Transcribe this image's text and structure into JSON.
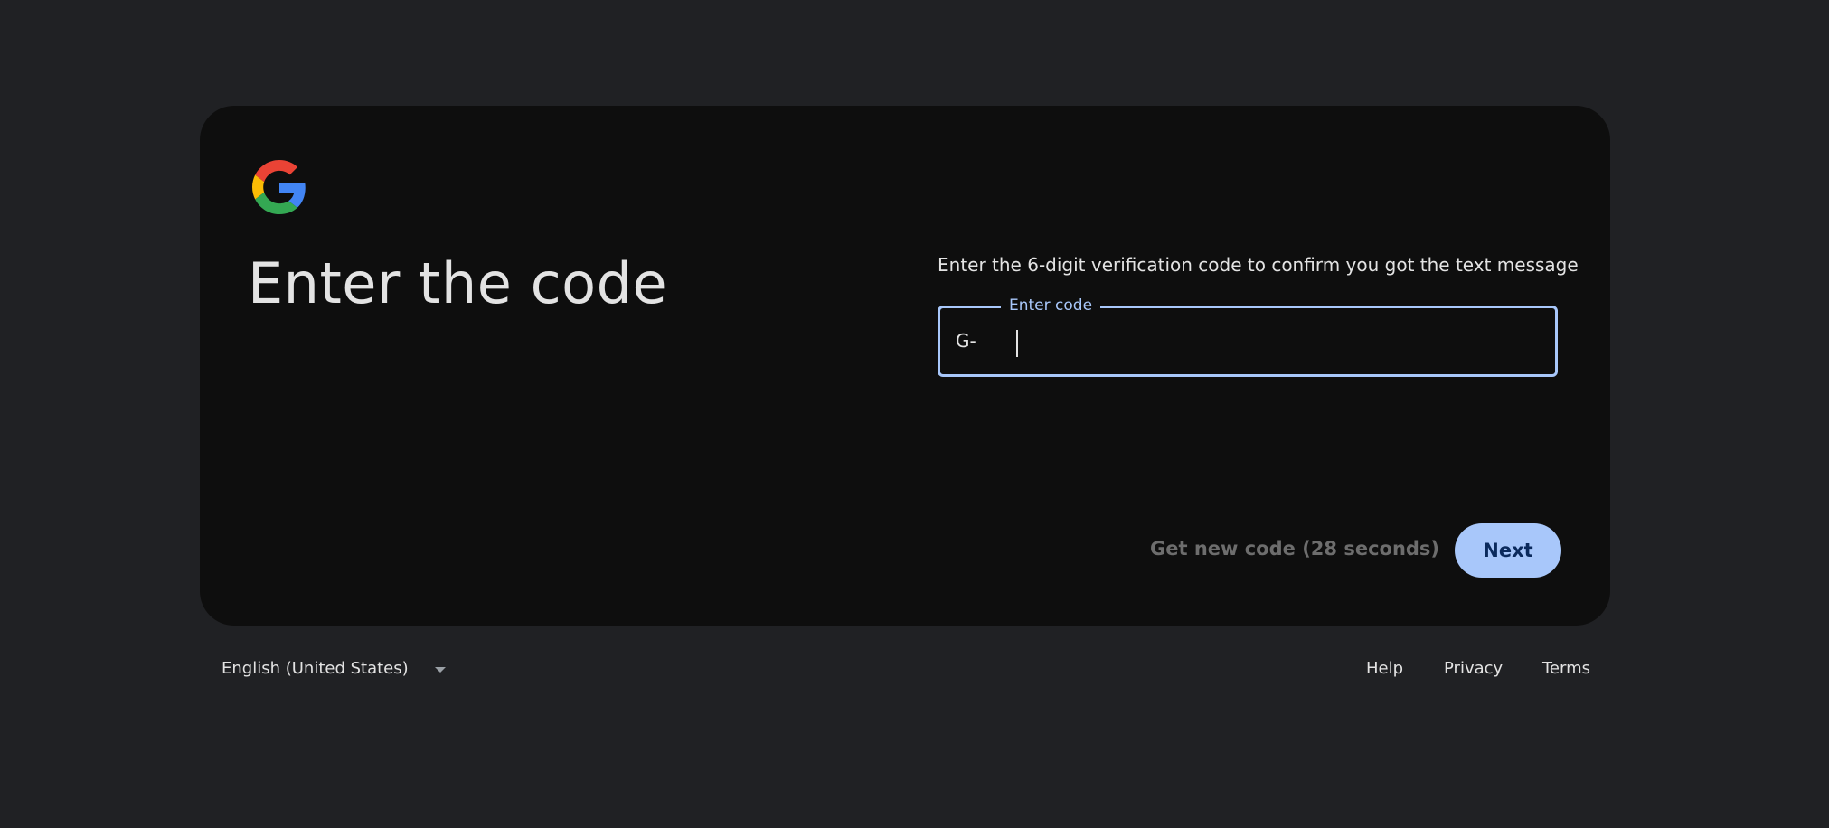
{
  "card": {
    "heading": "Enter the code",
    "instructions": "Enter the 6-digit verification code to confirm you got the text message",
    "code_field": {
      "label": "Enter code",
      "prefix": "G-",
      "value": ""
    },
    "resend_label": "Get new code (28 seconds)",
    "next_label": "Next"
  },
  "footer": {
    "language": "English (United States)",
    "links": {
      "help": "Help",
      "privacy": "Privacy",
      "terms": "Terms"
    }
  },
  "colors": {
    "background": "#202124",
    "card": "#0e0e0e",
    "accent": "#a8c7fa",
    "logo_red": "#ea4335",
    "logo_yellow": "#fbbc05",
    "logo_green": "#34a853",
    "logo_blue": "#4285f4"
  },
  "icons": {
    "logo": "google-g-logo",
    "language_dropdown": "chevron-down-icon"
  }
}
